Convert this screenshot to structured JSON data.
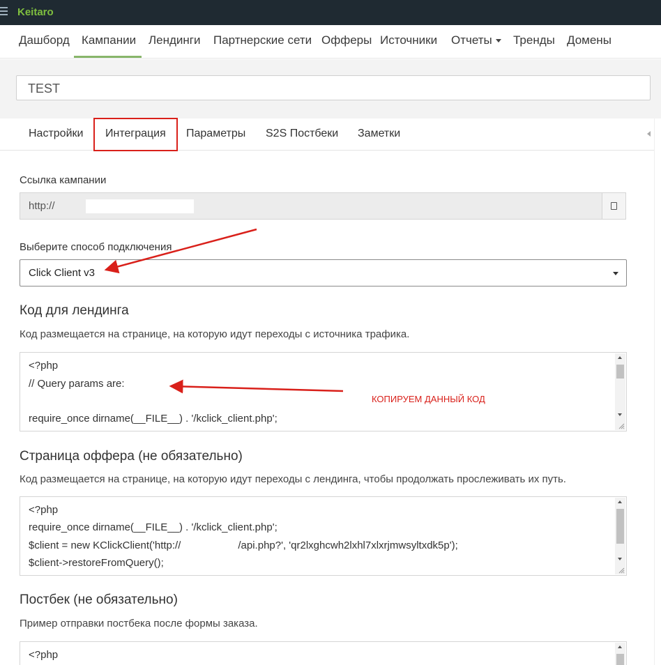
{
  "app": {
    "brand": "Keitaro"
  },
  "nav": {
    "items": [
      "Дашборд",
      "Кампании",
      "Лендинги",
      "Партнерские сети",
      "Офферы",
      "Источники",
      "Отчеты",
      "Тренды",
      "Домены"
    ],
    "active": "Кампании"
  },
  "campaign": {
    "name": "TEST"
  },
  "tabs": {
    "items": [
      "Настройки",
      "Интеграция",
      "Параметры",
      "S2S Постбеки",
      "Заметки"
    ],
    "active": "Интеграция"
  },
  "link": {
    "label": "Ссылка кампании",
    "value": "http://"
  },
  "method": {
    "label": "Выберите способ подключения",
    "value": "Click Client v3"
  },
  "landing": {
    "title": "Код для лендинга",
    "help": "Код размещается на странице, на которую идут переходы с источника трафика.",
    "lines": [
      "<?php",
      "// Query params are:",
      "",
      "require_once dirname(__FILE__) . '/kclick_client.php';"
    ]
  },
  "offer": {
    "title": "Страница оффера (не обязательно)",
    "help": "Код размещается на странице, на которую идут переходы с лендинга, чтобы продолжать прослеживать их путь.",
    "lines": [
      "<?php",
      "require_once dirname(__FILE__) . '/kclick_client.php';",
      "$client = new KClickClient('http://",
      "/api.php?', 'qr2lxghcwh2lxhl7xlxrjmwsyltxdk5p');",
      "$client->restoreFromQuery();"
    ]
  },
  "postback": {
    "title": "Постбек (не обязательно)",
    "help": "Пример отправки постбека после формы заказа.",
    "lines": [
      "<?php"
    ]
  },
  "annotation": {
    "text": "КОПИРУЕМ ДАННЫЙ КОД",
    "color": "#d9201a"
  },
  "colors": {
    "topbar": "#1f2a32",
    "brand": "#7fbf3f",
    "active_underline": "#88b66a",
    "highlight": "#d9201a"
  }
}
